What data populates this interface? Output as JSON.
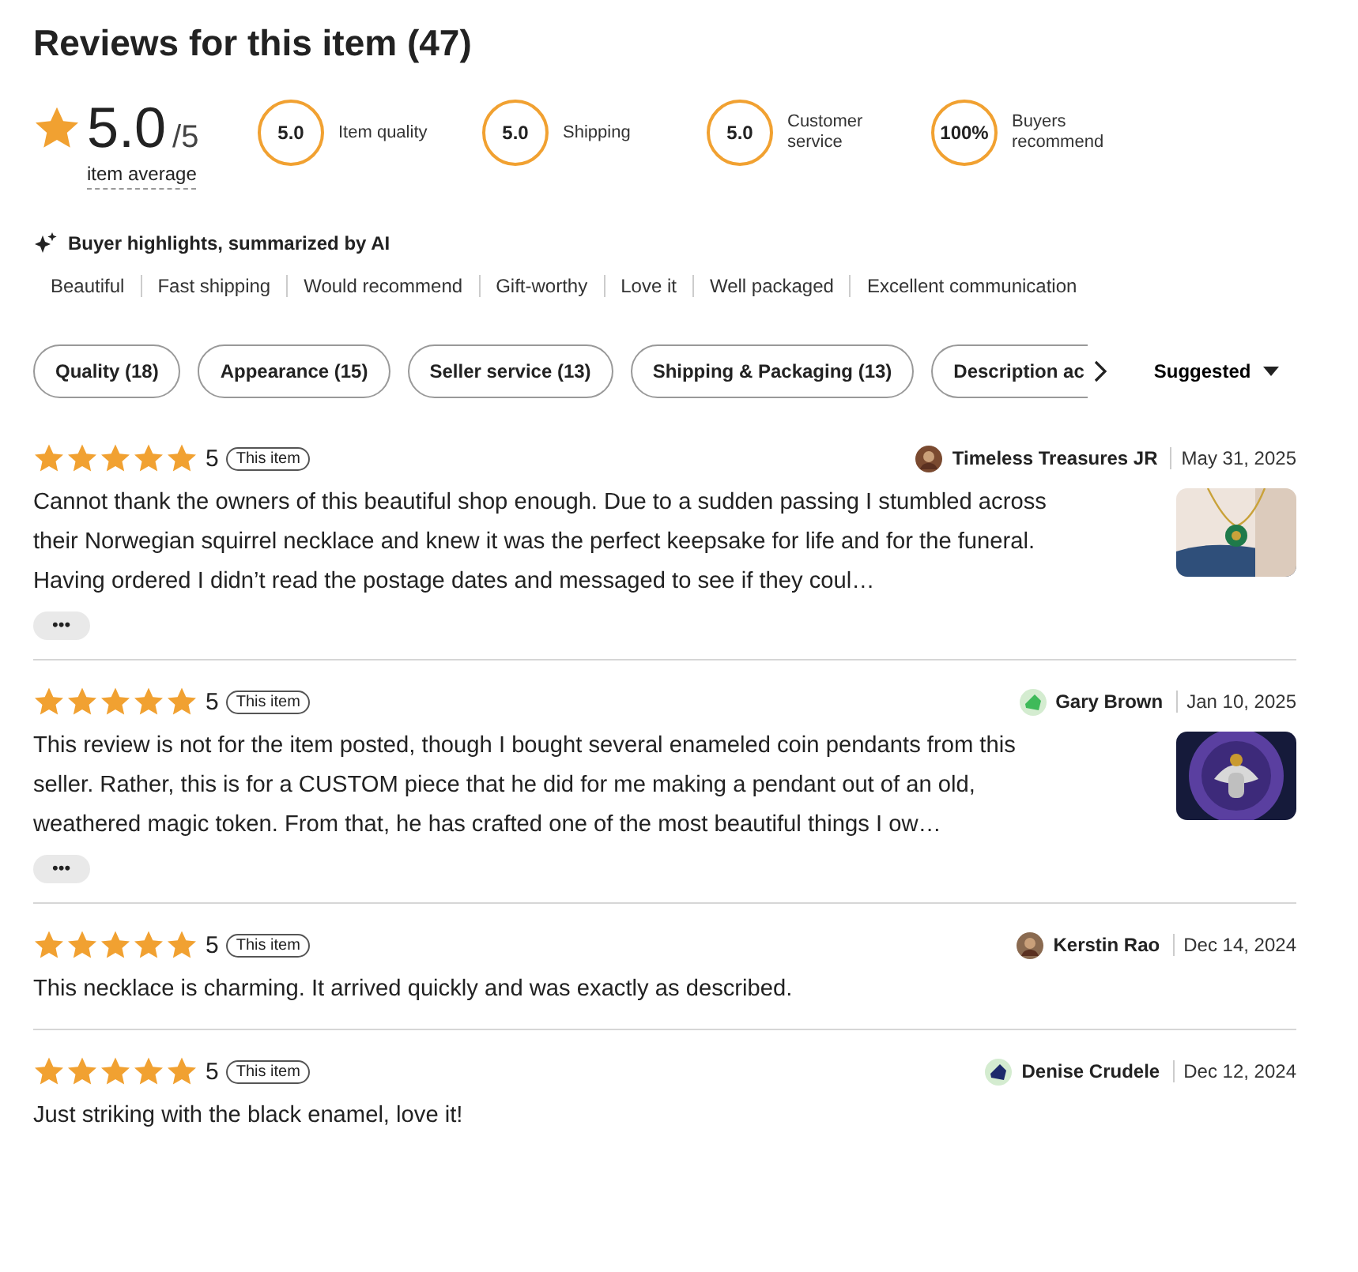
{
  "title": "Reviews for this item (47)",
  "summary": {
    "average": "5.0",
    "out_of": "/5",
    "label": "item average"
  },
  "metrics": [
    {
      "value": "5.0",
      "label": "Item quality"
    },
    {
      "value": "5.0",
      "label": "Shipping"
    },
    {
      "value": "5.0",
      "label": "Customer service"
    },
    {
      "value": "100%",
      "label": "Buyers recommend"
    }
  ],
  "highlights": {
    "heading": "Buyer highlights, summarized by AI",
    "tags": [
      "Beautiful",
      "Fast shipping",
      "Would recommend",
      "Gift-worthy",
      "Love it",
      "Well packaged",
      "Excellent communication"
    ]
  },
  "filters": [
    {
      "label": "Quality (18)",
      "selected": false
    },
    {
      "label": "Appearance (15)",
      "selected": false
    },
    {
      "label": "Seller service (13)",
      "selected": false
    },
    {
      "label": "Shipping & Packaging (13)",
      "selected": false
    },
    {
      "label": "Description ac",
      "selected": false
    }
  ],
  "sort": {
    "label": "Suggested"
  },
  "reviews": [
    {
      "stars": 5,
      "rating": "5",
      "badge": "This item",
      "reviewer": "Timeless Treasures JR",
      "date": "May 31, 2025",
      "text": "Cannot thank the owners of this beautiful shop enough. Due to a sudden passing I stumbled across their Norwegian squirrel necklace and knew it was the perfect keepsake for life and for the funeral. Having ordered I didn’t read the postage dates and messaged to see if they coul…",
      "more": "•••"
    },
    {
      "stars": 5,
      "rating": "5",
      "badge": "This item",
      "reviewer": "Gary Brown",
      "avatar": {
        "kind": "icon",
        "color": "#3fba5a"
      },
      "date": "Jan 10, 2025",
      "text": "This review is not for the item posted, though I bought several enameled coin pendants from this seller. Rather, this is for a CUSTOM piece that he did for me making a pendant out of an old, weathered magic token. From that, he has crafted one of the most beautiful things I ow…",
      "more": "•••"
    },
    {
      "stars": 5,
      "rating": "5",
      "badge": "This item",
      "reviewer": "Kerstin Rao",
      "date": "Dec 14, 2024",
      "text": "This necklace is charming. It arrived quickly and was exactly as described."
    },
    {
      "stars": 5,
      "rating": "5",
      "badge": "This item",
      "reviewer": "Denise Crudele",
      "avatar": {
        "kind": "icon",
        "color": "#1d2a6b"
      },
      "date": "Dec 12, 2024",
      "text": "Just striking with the black enamel, love it!"
    }
  ]
}
